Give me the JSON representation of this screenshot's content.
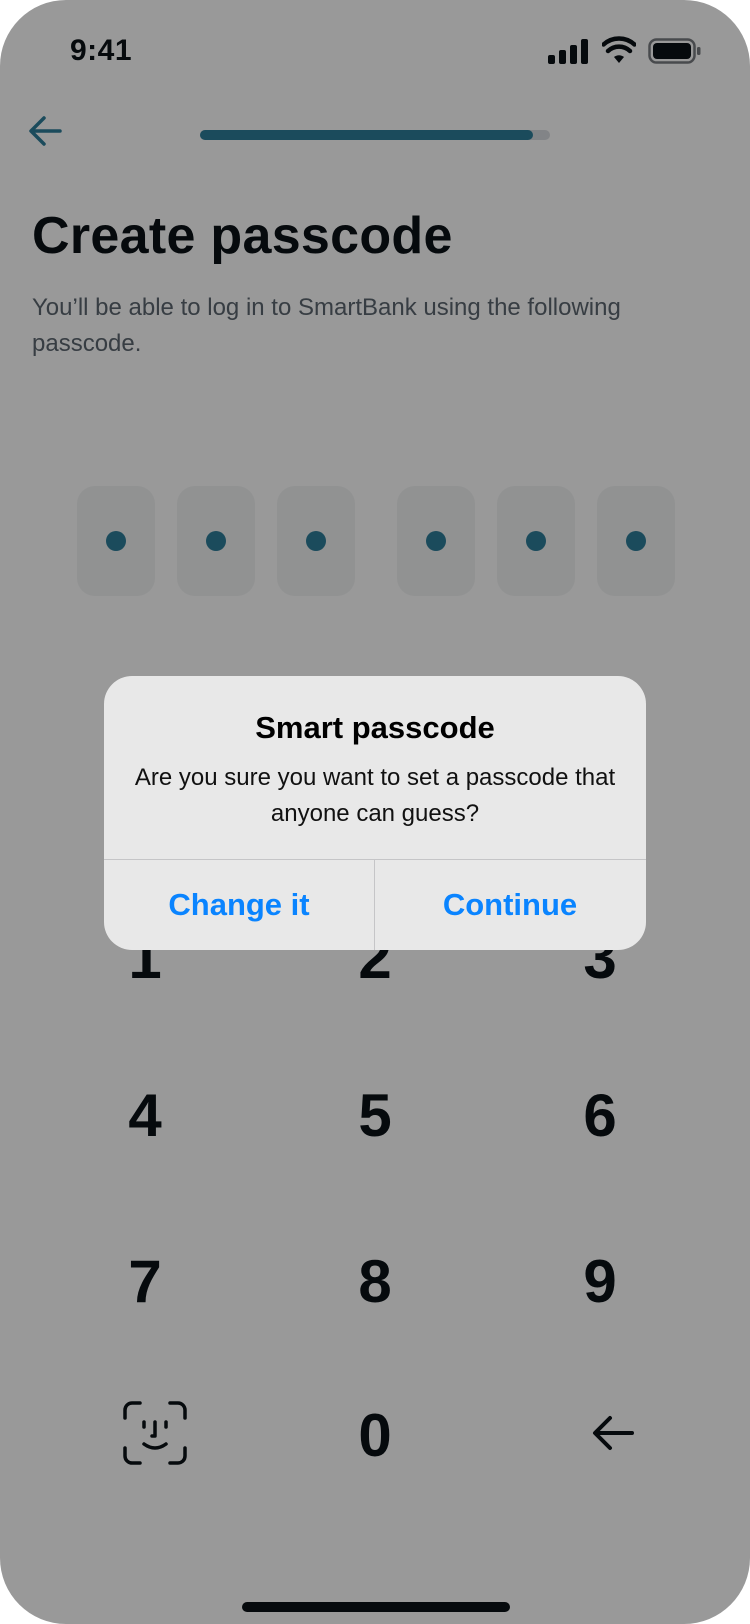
{
  "status_bar": {
    "time": "9:41"
  },
  "header": {
    "progress": 0.95
  },
  "page": {
    "title": "Create passcode",
    "subtitle": "You’ll be able to log in to SmartBank using the following passcode."
  },
  "passcode": {
    "length": 6,
    "filled": 6
  },
  "keypad": {
    "keys": [
      "1",
      "2",
      "3",
      "4",
      "5",
      "6",
      "7",
      "8",
      "9",
      "0"
    ]
  },
  "alert": {
    "title": "Smart passcode",
    "message": "Are you sure you want to set a passcode that anyone can guess?",
    "buttons": {
      "change": "Change it",
      "continue": "Continue"
    }
  },
  "colors": {
    "accent": "#2d7d9a",
    "link": "#0a84ff",
    "text": "#0b1117"
  },
  "icons": [
    "back-arrow-icon",
    "face-id-icon",
    "backspace-icon",
    "signal-icon",
    "wifi-icon",
    "battery-icon"
  ]
}
